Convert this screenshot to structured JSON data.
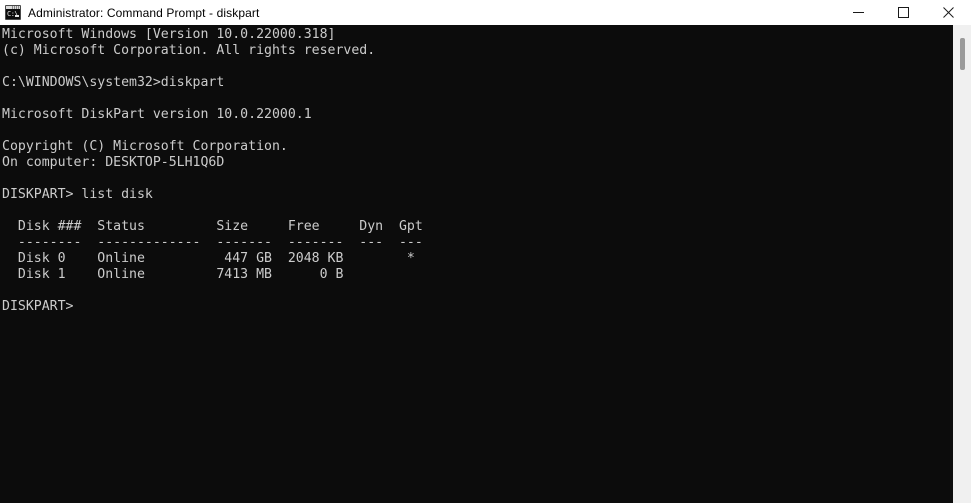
{
  "window": {
    "title": "Administrator: Command Prompt - diskpart",
    "icon": "cmd-console-icon",
    "icon_prompt_text": "C:\\",
    "background_color": "#0c0c0c",
    "text_color": "#cccccc",
    "titlebar_color": "#ffffff"
  },
  "controls": {
    "minimize_label": "Minimize",
    "maximize_label": "Maximize",
    "close_label": "Close"
  },
  "terminal": {
    "lines": [
      "Microsoft Windows [Version 10.0.22000.318]",
      "(c) Microsoft Corporation. All rights reserved.",
      "",
      "C:\\WINDOWS\\system32>diskpart",
      "",
      "Microsoft DiskPart version 10.0.22000.1",
      "",
      "Copyright (C) Microsoft Corporation.",
      "On computer: DESKTOP-5LH1Q6D",
      "",
      "DISKPART> list disk",
      "",
      "  Disk ###  Status         Size     Free     Dyn  Gpt",
      "  --------  -------------  -------  -------  ---  ---",
      "  Disk 0    Online          447 GB  2048 KB        *",
      "  Disk 1    Online         7413 MB      0 B",
      "",
      "DISKPART>"
    ]
  },
  "disk_table": {
    "headers": [
      "Disk ###",
      "Status",
      "Size",
      "Free",
      "Dyn",
      "Gpt"
    ],
    "rows": [
      {
        "disk": "Disk 0",
        "status": "Online",
        "size": "447 GB",
        "free": "2048 KB",
        "dyn": "",
        "gpt": "*"
      },
      {
        "disk": "Disk 1",
        "status": "Online",
        "size": "7413 MB",
        "free": "0 B",
        "dyn": "",
        "gpt": ""
      }
    ]
  },
  "session": {
    "os_version": "10.0.22000.318",
    "diskpart_version": "10.0.22000.1",
    "computer_name": "DESKTOP-5LH1Q6D",
    "working_directory": "C:\\WINDOWS\\system32",
    "command_entered": "diskpart",
    "diskpart_command": "list disk",
    "prompt": "DISKPART>"
  },
  "scrollbar": {
    "thumb_position_label": "near-top",
    "track_color": "#f0f0f0",
    "thumb_color": "#9a9a9a"
  }
}
